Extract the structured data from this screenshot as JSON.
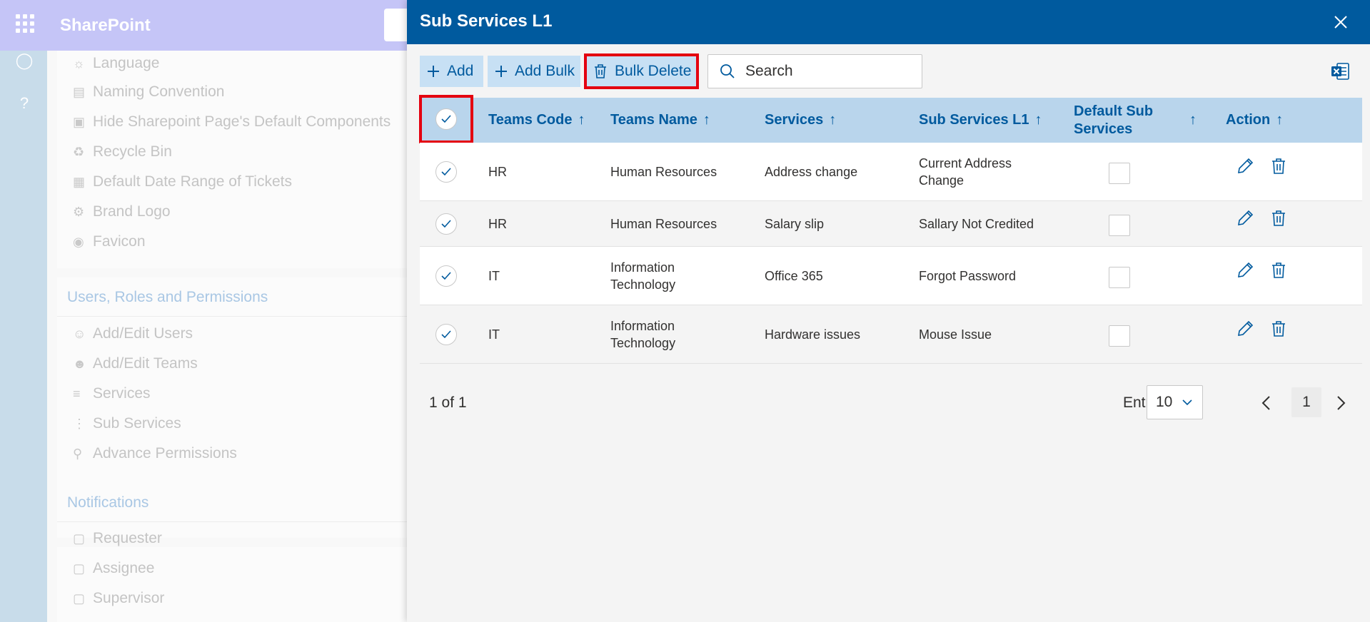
{
  "app": {
    "title": "SharePoint"
  },
  "background_nav": {
    "items_top": [
      {
        "icon": "language-icon",
        "label": "Language"
      },
      {
        "icon": "naming-convention-icon",
        "label": "Naming Convention"
      },
      {
        "icon": "page-icon",
        "label": "Hide Sharepoint Page's Default Components"
      },
      {
        "icon": "recycle-bin-icon",
        "label": "Recycle Bin"
      },
      {
        "icon": "calendar-icon",
        "label": "Default Date Range of Tickets"
      },
      {
        "icon": "brand-logo-icon",
        "label": "Brand Logo"
      },
      {
        "icon": "favicon-icon",
        "label": "Favicon"
      }
    ],
    "section_users": "Users, Roles and Permissions",
    "items_users": [
      {
        "icon": "users-icon",
        "label": "Add/Edit Users"
      },
      {
        "icon": "teams-icon",
        "label": "Add/Edit Teams"
      },
      {
        "icon": "list-icon",
        "label": "Services"
      },
      {
        "icon": "sub-list-icon",
        "label": "Sub Services"
      },
      {
        "icon": "key-icon",
        "label": "Advance Permissions"
      }
    ],
    "section_notifications": "Notifications",
    "items_notifications": [
      {
        "icon": "comment-icon",
        "label": "Requester"
      },
      {
        "icon": "comment-icon",
        "label": "Assignee"
      },
      {
        "icon": "comment-icon",
        "label": "Supervisor"
      }
    ]
  },
  "panel": {
    "title": "Sub Services L1",
    "toolbar": {
      "add_label": "Add",
      "add_bulk_label": "Add Bulk",
      "bulk_delete_label": "Bulk Delete",
      "search_placeholder": "Search"
    },
    "columns": [
      "Teams Code",
      "Teams Name",
      "Services",
      "Sub Services L1",
      "Default Sub Services",
      "Action"
    ],
    "rows": [
      {
        "teams_code": "HR",
        "teams_name": "Human Resources",
        "service": "Address change",
        "sub_service": "Current Address Change",
        "default": false
      },
      {
        "teams_code": "HR",
        "teams_name": "Human Resources",
        "service": "Salary slip",
        "sub_service": "Sallary Not Credited",
        "default": false
      },
      {
        "teams_code": "IT",
        "teams_name": "Information Technology",
        "service": "Office 365",
        "sub_service": "Forgot Password",
        "default": false
      },
      {
        "teams_code": "IT",
        "teams_name": "Information Technology",
        "service": "Hardware issues",
        "sub_service": "Mouse Issue",
        "default": false
      }
    ],
    "pagination": {
      "summary": "1 of 1",
      "entries_label": "Entries",
      "entries_value": "10",
      "current_page": "1"
    }
  },
  "colors": {
    "header": "#005a9e",
    "accent": "#005a9e",
    "highlight": "#e4000f"
  }
}
